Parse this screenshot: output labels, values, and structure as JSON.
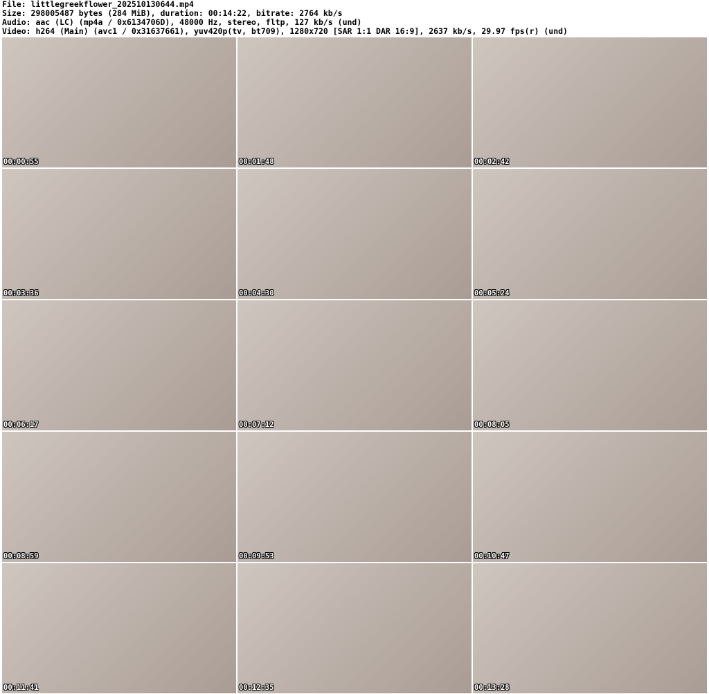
{
  "header": {
    "file": "File: littlegreekflower_202510130644.mp4",
    "size": "Size: 298005487 bytes (284 MiB), duration: 00:14:22, bitrate: 2764 kb/s",
    "audio": "Audio: aac (LC) (mp4a / 0x6134706D), 48000 Hz, stereo, fltp, 127 kb/s (und)",
    "video": "Video: h264 (Main) (avc1 / 0x31637661), yuv420p(tv, bt709), 1280x720 [SAR 1:1 DAR 16:9], 2637 kb/s, 29.97 fps(r) (und)"
  },
  "thumbnails": [
    "00:00:55",
    "00:01:48",
    "00:02:42",
    "00:03:36",
    "00:04:30",
    "00:05:24",
    "00:06:17",
    "00:07:12",
    "00:08:05",
    "00:08:59",
    "00:09:53",
    "00:10:47",
    "00:11:41",
    "00:12:35",
    "00:13:28"
  ]
}
